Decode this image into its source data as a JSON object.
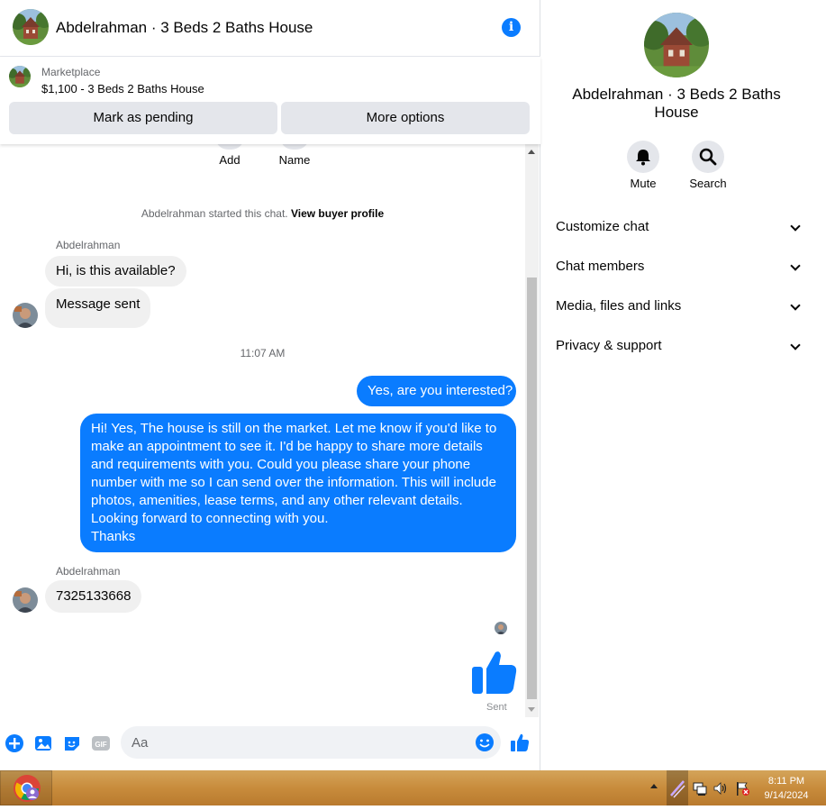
{
  "header": {
    "title": "Abdelrahman · 3 Beds 2 Baths House",
    "info_icon": "i"
  },
  "marketplace": {
    "label": "Marketplace",
    "listing": "$1,100 - 3 Beds 2 Baths House",
    "pending_button": "Mark as pending",
    "more_button": "More options"
  },
  "conversation": {
    "top_actions": [
      "Add",
      "Name"
    ],
    "system_message": "Abdelrahman started this chat.",
    "system_link": "View buyer profile",
    "sender_name": "Abdelrahman",
    "incoming_1": "Hi, is this available?",
    "incoming_2": "Message sent",
    "timestamp": "11:07 AM",
    "outgoing_1": "Yes, are you interested?",
    "outgoing_2_lines": [
      "Hi! Yes, The house is still on the market. Let me know if you'd like to",
      "make an appointment to see it. I'd be happy to share more details",
      "and requirements with you. Could you please share your phone",
      "number with me so I can send over the information. This will include",
      "photos, amenities, lease terms, and any other relevant details.",
      "Looking forward to connecting with you.",
      "Thanks"
    ],
    "sender_name_2": "Abdelrahman",
    "incoming_3": "7325133668",
    "sent_status": "Sent"
  },
  "composer": {
    "placeholder": "Aa",
    "icons": [
      "plus-icon",
      "photo-icon",
      "sticker-icon",
      "gif-icon",
      "emoji-icon",
      "like-icon"
    ]
  },
  "info_panel": {
    "title_line1": "Abdelrahman · 3 Beds 2 Baths",
    "title_line2": "House",
    "mute_label": "Mute",
    "search_label": "Search",
    "sections": [
      "Customize chat",
      "Chat members",
      "Media, files and links",
      "Privacy & support"
    ]
  },
  "taskbar": {
    "time": "8:11 PM",
    "date": "9/14/2024"
  },
  "colors": {
    "accent": "#0a7cff",
    "incoming_bubble": "#f0f0f0",
    "taskbar": "#c88c3c"
  }
}
